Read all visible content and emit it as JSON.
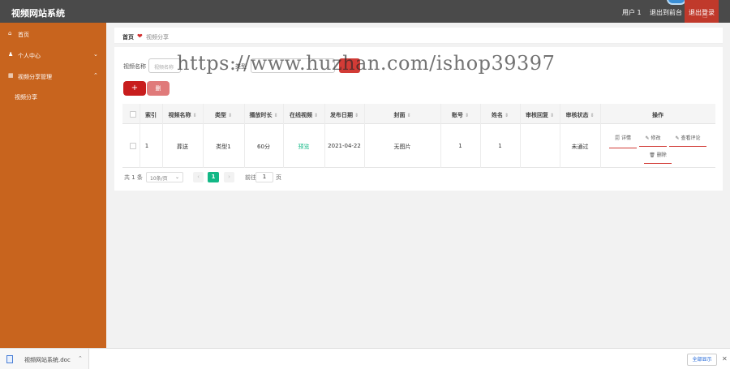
{
  "header": {
    "title": "视频网站系统",
    "user_label": "用户 1",
    "back_label": "退出到前台",
    "logout_label": "退出登录"
  },
  "sidebar": {
    "items": [
      {
        "label": "首页",
        "icon": "home-icon"
      },
      {
        "label": "个人中心",
        "icon": "person-icon"
      },
      {
        "label": "视频分享管理",
        "icon": "grid-icon"
      }
    ],
    "sub_items": [
      {
        "label": "视频分享"
      }
    ]
  },
  "breadcrumb": {
    "home": "首页",
    "current": "视频分享"
  },
  "filters": {
    "name_label": "视频名称",
    "name_placeholder": "视频名称",
    "type_label": "类型"
  },
  "actions": {
    "add_label": "+",
    "delete_label": "删"
  },
  "table": {
    "columns": [
      "索引",
      "视频名称",
      "类型",
      "播放时长",
      "在线视频",
      "发布日期",
      "封面",
      "账号",
      "姓名",
      "审核回复",
      "审核状态",
      "操作"
    ],
    "rows": [
      {
        "index": "1",
        "name": "葬送",
        "type": "类型1",
        "duration": "60分",
        "online": "预览",
        "date": "2021-04-22",
        "cover": "无图片",
        "account": "1",
        "realname": "1",
        "reply": "",
        "status": "未通过",
        "ops": [
          "详情",
          "修改",
          "查看评论",
          "删除"
        ]
      }
    ]
  },
  "pagination": {
    "total": "共 1 条",
    "page_size": "10条/页",
    "current": "1",
    "goto_label": "前往",
    "goto_value": "1",
    "page_suffix": "页"
  },
  "watermark": "https://www.huzhan.com/ishop39397",
  "download_bar": {
    "file_name": "视频网站系统.doc",
    "show_all": "全部显示"
  },
  "colors": {
    "sidebar": "#c8641e",
    "topbar": "#4a4a4a",
    "accent": "#d23b36",
    "page_active": "#12b886"
  }
}
